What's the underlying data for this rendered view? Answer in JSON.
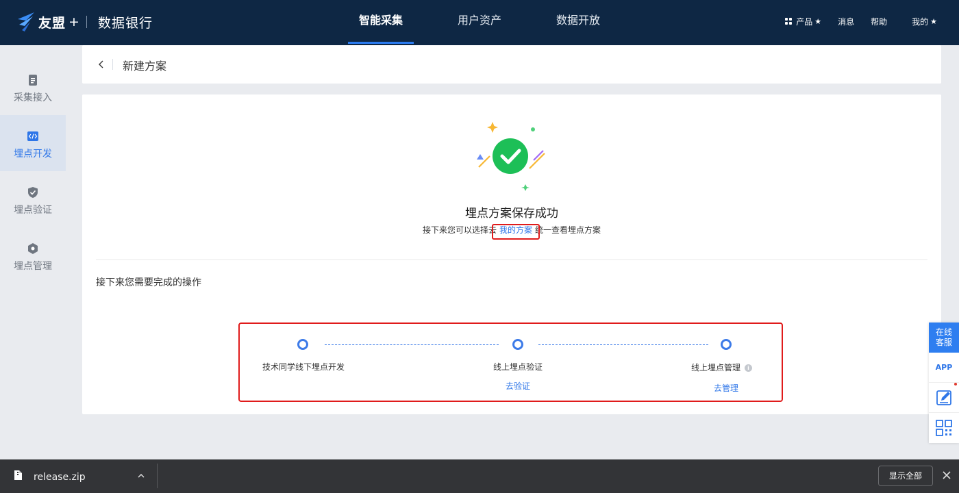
{
  "brand": {
    "name": "友盟",
    "plus": "+",
    "product": "数据银行"
  },
  "nav": {
    "tabs": [
      {
        "label": "智能采集",
        "active": true
      },
      {
        "label": "用户资产",
        "active": false
      },
      {
        "label": "数据开放",
        "active": false
      }
    ],
    "right": {
      "products": "产品",
      "messages": "消息",
      "help": "帮助",
      "mine": "我的",
      "star": "★"
    }
  },
  "sidebar": {
    "items": [
      {
        "label": "采集接入",
        "icon": "document-icon",
        "active": false
      },
      {
        "label": "埋点开发",
        "icon": "code-icon",
        "active": true
      },
      {
        "label": "埋点验证",
        "icon": "shield-check-icon",
        "active": false
      },
      {
        "label": "埋点管理",
        "icon": "hexagon-icon",
        "active": false
      }
    ]
  },
  "header": {
    "title": "新建方案"
  },
  "success": {
    "title": "埋点方案保存成功",
    "desc_prefix": "接下来您可以选择去",
    "desc_link": "我的方案",
    "desc_suffix": "统一查看埋点方案"
  },
  "ops": {
    "title": "接下来您需要完成的操作",
    "steps": [
      {
        "label": "技术同学线下埋点开发",
        "link": ""
      },
      {
        "label": "线上埋点验证",
        "link": "去验证"
      },
      {
        "label": "线上埋点管理",
        "link": "去管理",
        "info": "i"
      }
    ]
  },
  "float": {
    "service": "在线客服",
    "service_l1": "在线",
    "service_l2": "客服",
    "app": "APP"
  },
  "download": {
    "filename": "release.zip",
    "show_all": "显示全部"
  },
  "colors": {
    "nav_bg": "#0e2744",
    "accent": "#2e76e8",
    "success": "#1dbf57",
    "highlight": "#e01b1b"
  }
}
